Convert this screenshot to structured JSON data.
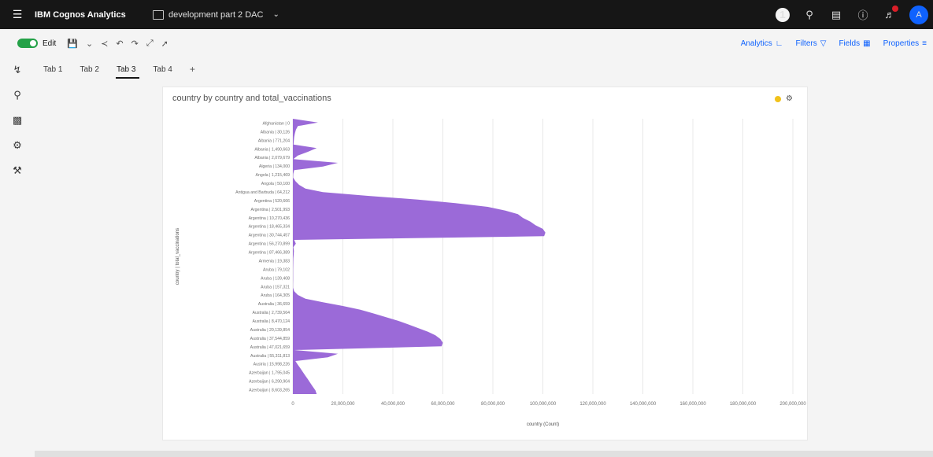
{
  "topbar": {
    "brand": "IBM Cognos Analytics",
    "report_name": "development part 2 DAC",
    "avatar_letter": "A",
    "badge_count": "1"
  },
  "toolbar": {
    "edit_label": "Edit",
    "analytics_label": "Analytics",
    "filters_label": "Filters",
    "fields_label": "Fields",
    "properties_label": "Properties"
  },
  "tabs": [
    {
      "label": "Tab 1"
    },
    {
      "label": "Tab 2"
    },
    {
      "label": "Tab 3"
    },
    {
      "label": "Tab 4"
    }
  ],
  "tab_add": "+",
  "widget": {
    "title": "country by country and total_vaccinations"
  },
  "colors": {
    "series": "#9b6ad8",
    "accent": "#0f62fe"
  },
  "chart_data": {
    "type": "area",
    "orientation": "horizontal",
    "ylabel": "country | total_vaccinations",
    "xlabel": "country (Count)",
    "xlim": [
      0,
      200000000
    ],
    "grid": true,
    "x_ticks": [
      "0",
      "20,000,000",
      "40,000,000",
      "60,000,000",
      "80,000,000",
      "100,000,000",
      "120,000,000",
      "140,000,000",
      "160,000,000",
      "180,000,000",
      "200,000,000"
    ],
    "categories": [
      "Afghanistan | 0",
      "Albania | 30,126",
      "Albania | 771,204",
      "Albania | 1,490,663",
      "Albania | 2,079,679",
      "Algeria | 134,000",
      "Angola | 1,215,469",
      "Angola | 50,100",
      "Antigua and Barbuda | 64,212",
      "Argentina | 520,666",
      "Argentina | 2,501,993",
      "Argentina | 10,270,436",
      "Argentina | 18,465,334",
      "Argentina | 30,744,457",
      "Argentina | 56,270,899",
      "Argentina | 87,466,389",
      "Armenia | 19,383",
      "Aruba | 79,102",
      "Aruba | 139,408",
      "Aruba | 157,321",
      "Aruba | 164,305",
      "Australia | 36,659",
      "Australia | 2,739,564",
      "Australia | 8,470,124",
      "Australia | 20,139,854",
      "Australia | 37,544,859",
      "Australia | 47,021,659",
      "Australia | 55,311,813",
      "Austria | 15,998,226",
      "Azerbaijan | 1,795,045",
      "Azerbaijan | 6,290,904",
      "Azerbaijan | 8,603,265"
    ],
    "values": [
      0,
      10000000,
      2000000,
      1200000,
      800000,
      500000,
      380000,
      240000,
      9500000,
      6000000,
      2000000,
      200000,
      18000000,
      12000000,
      500000,
      150000,
      100000,
      1000000,
      2500000,
      5000000,
      12000000,
      30000000,
      50000000,
      65000000,
      78000000,
      85000000,
      90000000,
      92000000,
      95000000,
      97000000,
      100000000,
      101000000,
      100500000,
      500000,
      1200000,
      200000,
      400000,
      300000,
      200000,
      150000,
      120000,
      100000,
      100000,
      100000,
      80000,
      60000,
      50000,
      500000,
      2000000,
      5000000,
      12000000,
      20000000,
      27000000,
      32000000,
      37000000,
      42000000,
      46000000,
      50000000,
      54000000,
      57000000,
      59000000,
      60000000,
      59500000,
      500000,
      18000000,
      14000000,
      1000000,
      2000000,
      3000000,
      4000000,
      5000000,
      6000000,
      7000000,
      8000000,
      9000000,
      9500000
    ]
  }
}
